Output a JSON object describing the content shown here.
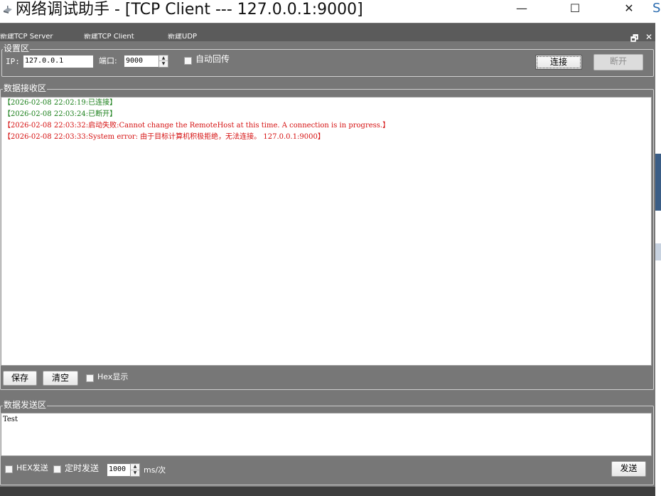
{
  "window": {
    "title": "网络调试助手 - [TCP Client --- 127.0.0.1:9000]",
    "minimize_glyph": "—",
    "maximize_glyph": "☐",
    "close_glyph": "✕",
    "edge_glyph": "S"
  },
  "menu": {
    "items": [
      "新建TCP Server",
      "新建TCP Client",
      "新建UDP"
    ],
    "mdi_restore": "🗗",
    "mdi_close": "✕"
  },
  "settings": {
    "group_label": "设置区",
    "ip_label": "IP:",
    "ip_value": "127.0.0.1",
    "port_label": "端口:",
    "port_value": "9000",
    "auto_echo_label": "自动回传",
    "auto_echo_checked": false,
    "connect_label": "连接",
    "disconnect_label": "断开"
  },
  "receive": {
    "group_label": "数据接收区",
    "lines": [
      {
        "text": "【2026-02-08 22:02:19:已连接】",
        "color": "#1a7f1a"
      },
      {
        "text": "【2026-02-08 22:03:24:已断开】",
        "color": "#1a7f1a"
      },
      {
        "text": "【2026-02-08 22:03:32:启动失败:Cannot change the RemoteHost at this time. A connection is in progress.】",
        "color": "#d51010"
      },
      {
        "text": "【2026-02-08 22:03:33:System error: 由于目标计算机积极拒绝，无法连接。 127.0.0.1:9000】",
        "color": "#d51010"
      }
    ],
    "save_label": "保存",
    "clear_label": "清空",
    "hex_display_label": "Hex显示",
    "hex_display_checked": false
  },
  "send": {
    "group_label": "数据发送区",
    "text": "Test",
    "hex_send_label": "HEX发送",
    "hex_send_checked": false,
    "timed_send_label": "定时发送",
    "timed_send_checked": false,
    "interval_value": "1000",
    "interval_unit": "ms/次",
    "send_label": "发送"
  },
  "colors": {
    "background": "#777777",
    "log_success": "#1a7f1a",
    "log_error": "#d51010"
  }
}
